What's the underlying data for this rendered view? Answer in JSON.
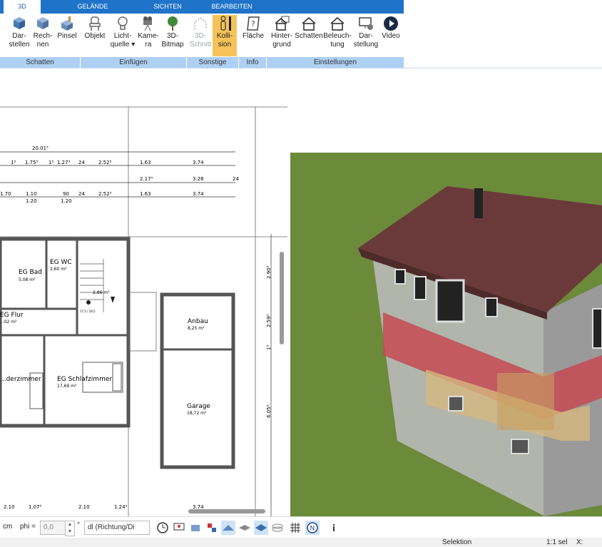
{
  "tabs": [
    {
      "label": "3D",
      "active": true
    },
    {
      "label": "GELÄNDE",
      "active": false
    },
    {
      "label": "SICHTEN",
      "active": false
    },
    {
      "label": "BEARBEITEN",
      "active": false
    }
  ],
  "ribbon": {
    "buttons": [
      {
        "line1": "Dar-",
        "line2": "stellen",
        "icon": "cube-render-icon",
        "state": "normal"
      },
      {
        "line1": "Rech-",
        "line2": "nen",
        "icon": "cube-calculate-icon",
        "state": "normal"
      },
      {
        "line1": "Pinsel",
        "line2": "",
        "icon": "brush-cube-icon",
        "state": "normal"
      },
      {
        "line1": "Objekt",
        "line2": "",
        "icon": "chair-icon",
        "state": "normal"
      },
      {
        "line1": "Licht-",
        "line2": "quelle ▾",
        "icon": "lightbulb-icon",
        "state": "normal"
      },
      {
        "line1": "Kame-",
        "line2": "ra",
        "icon": "camera-icon",
        "state": "normal"
      },
      {
        "line1": "3D-",
        "line2": "Bitmap",
        "icon": "tree-icon",
        "state": "normal"
      },
      {
        "line1": "3D-",
        "line2": "Schnitt",
        "icon": "section-cut-icon",
        "state": "disabled"
      },
      {
        "line1": "Kolli-",
        "line2": "sion",
        "icon": "person-collision-icon",
        "state": "active"
      },
      {
        "line1": "Fläche",
        "line2": "",
        "icon": "area-question-icon",
        "state": "normal"
      },
      {
        "line1": "Hinter-",
        "line2": "grund",
        "icon": "house-background-icon",
        "state": "normal"
      },
      {
        "line1": "Schatten",
        "line2": "",
        "icon": "house-shadow-icon",
        "state": "normal"
      },
      {
        "line1": "Beleuch-",
        "line2": "tung",
        "icon": "house-light-icon",
        "state": "normal"
      },
      {
        "line1": "Dar-",
        "line2": "stellung",
        "icon": "monitor-settings-icon",
        "state": "normal"
      },
      {
        "line1": "Video",
        "line2": "",
        "icon": "play-icon",
        "state": "normal"
      }
    ],
    "groups": [
      "Schatten",
      "Einfügen",
      "Sonstige",
      "Info",
      "Einstellungen"
    ]
  },
  "plan": {
    "rooms": [
      {
        "name": "EG Bad",
        "area": "5,08 m²"
      },
      {
        "name": "EG WC",
        "area": "2,60 m²"
      },
      {
        "name": "EG Flur",
        "area": "...02 m²"
      },
      {
        "name": "...derzimmer",
        "area": ""
      },
      {
        "name": "EG Schlafzimmer",
        "area": "17,69 m²"
      },
      {
        "name": "Anbau",
        "area": "8,25 m²"
      },
      {
        "name": "Garage",
        "area": "18,72 m²"
      }
    ],
    "stair_label": "2,86 m²",
    "stair_sub": "17,5 / 28,5",
    "dims_row1": [
      "20.01⁵"
    ],
    "dims_row2": [
      "1⁵",
      "1.75⁵",
      "1⁵",
      "1.27⁵",
      "24",
      "2.52⁵",
      "1.63",
      "3.74"
    ],
    "dims_row3": [
      "2.17⁵",
      "3.26",
      "24"
    ],
    "dims_row4": [
      "1.70",
      "1.10",
      "90",
      "24",
      "2.52⁵",
      "1.63",
      "3.74"
    ],
    "dims_row4b": [
      "1.20",
      "1.20"
    ],
    "vert_dims": [
      "2.90⁵",
      "2.59⁵",
      "1⁵",
      "6.05⁵"
    ],
    "bottom_dims": [
      "2.10",
      "1.07⁵",
      "2.10",
      "1.24⁵",
      "3.74"
    ]
  },
  "statusbar": {
    "unit": "cm",
    "phi_label": "phi =",
    "phi_value": "0,0",
    "deg": "°",
    "direction_value": "dl (Richtung/Di",
    "selection": "Selektion",
    "scale": "1:1 sel",
    "x_label": "X:"
  },
  "colors": {
    "tab_bg": "#1f73c8",
    "group_bg": "#aed0f4",
    "active_btn": "#f6c35a",
    "grass": "#6b8a3a",
    "roof": "#6a3a3a"
  }
}
